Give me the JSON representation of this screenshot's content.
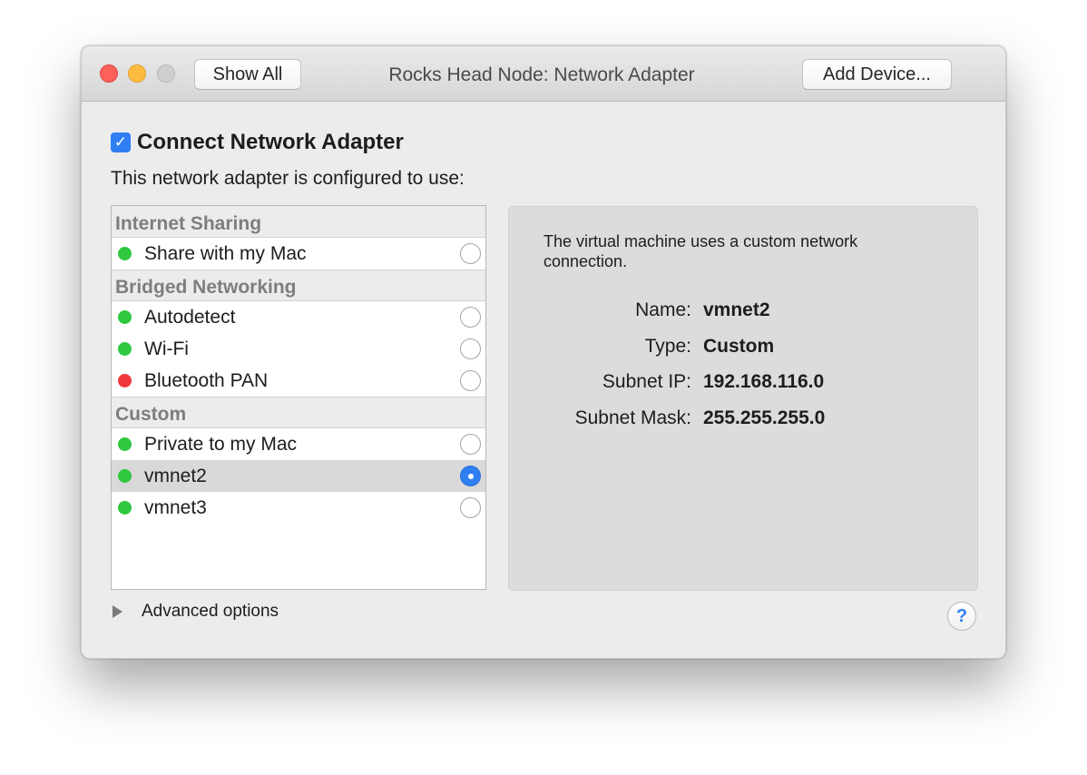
{
  "window": {
    "title": "Rocks Head Node: Network Adapter",
    "show_all_label": "Show All",
    "add_device_label": "Add Device..."
  },
  "connect": {
    "checked": true,
    "label": "Connect Network Adapter",
    "check_glyph": "✓"
  },
  "config_label": "This network adapter is configured to use:",
  "groups": [
    {
      "header": "Internet Sharing",
      "items": [
        {
          "label": "Share with my Mac",
          "status_color": "#2fc840",
          "selected": false
        }
      ]
    },
    {
      "header": "Bridged Networking",
      "items": [
        {
          "label": "Autodetect",
          "status_color": "#2fc840",
          "selected": false
        },
        {
          "label": "Wi-Fi",
          "status_color": "#2fc840",
          "selected": false
        },
        {
          "label": "Bluetooth PAN",
          "status_color": "#f0383a",
          "selected": false
        }
      ]
    },
    {
      "header": "Custom",
      "items": [
        {
          "label": "Private to my Mac",
          "status_color": "#2fc840",
          "selected": false
        },
        {
          "label": "vmnet2",
          "status_color": "#2fc840",
          "selected": true
        },
        {
          "label": "vmnet3",
          "status_color": "#2fc840",
          "selected": false
        }
      ]
    }
  ],
  "info": {
    "description": "The virtual machine uses a custom network connection.",
    "name_key": "Name:",
    "name_value": "vmnet2",
    "type_key": "Type:",
    "type_value": "Custom",
    "subnet_ip_key": "Subnet IP:",
    "subnet_ip_value": "192.168.116.0",
    "subnet_mask_key": "Subnet Mask:",
    "subnet_mask_value": "255.255.255.0"
  },
  "advanced_label": "Advanced options",
  "help_glyph": "?",
  "accent_color": "#2f7ff3"
}
